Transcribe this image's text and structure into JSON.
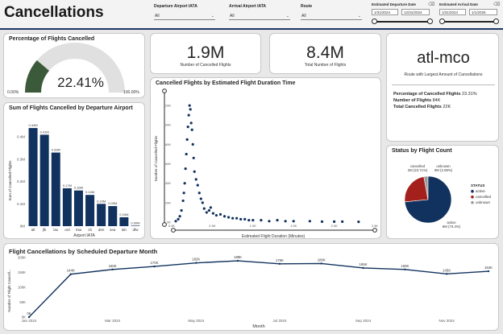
{
  "header": {
    "title": "Cancellations",
    "slicers": [
      {
        "label": "Departure Airport IATA",
        "value": "All"
      },
      {
        "label": "Arrival Airport IATA",
        "value": "All"
      },
      {
        "label": "Route",
        "value": "All"
      }
    ],
    "departure_date": {
      "label": "Estimated Departure Date",
      "from": "1/31/2024",
      "to": "12/31/2024"
    },
    "arrival_date": {
      "label": "Estimated Arrival Date",
      "from": "1/31/2024",
      "to": "1/1/2025"
    }
  },
  "gauge": {
    "title": "Percentage of Flights Cancelled",
    "value": "22.41%",
    "min_label": "0.00%",
    "max_label": "100.00%",
    "fraction": 0.2241
  },
  "kpis": [
    {
      "value": "1.9M",
      "label": "Number of Cancelled Flights"
    },
    {
      "value": "8.4M",
      "label": "Total Number of Flights"
    }
  ],
  "route_card": {
    "value": "atl-mco",
    "label": "Route with Largest Amount of Cancellations",
    "stats": [
      {
        "label": "Percentage of Cancelled Flights",
        "value": "23.31%"
      },
      {
        "label": "Number of Flights",
        "value": "84K"
      },
      {
        "label": "Total Cancelled Flights",
        "value": "22K"
      }
    ]
  },
  "colors": {
    "navy": "#11325e",
    "green": "#3b5a3a",
    "red": "#a4201d",
    "gray": "#9a9a9a",
    "gauge_bg": "#e0e0e0"
  },
  "chart_data": [
    {
      "type": "bar",
      "title": "Sum of Flights Cancelled by Departure Airport",
      "xlabel": "Airport IATA",
      "ylabel": "Sum of Cancelled Flights",
      "categories": [
        "atl",
        "jfk",
        "lax",
        "ord",
        "mia",
        "clt",
        "den",
        "sea",
        "lah",
        "dfw"
      ],
      "values": [
        0.44,
        0.41,
        0.33,
        0.17,
        0.16,
        0.14,
        0.1,
        0.09,
        0.04,
        0.0
      ],
      "data_labels": [
        "0.44M",
        "0.41M",
        "0.33M",
        "0.17M",
        "0.16M",
        "0.14M",
        "0.10M",
        "0.09M",
        "0.04M",
        "0.00M"
      ],
      "yticks": [
        "0M",
        "0.1M",
        "0.2M",
        "0.3M",
        "0.4M"
      ],
      "ylim": [
        0,
        0.48
      ]
    },
    {
      "type": "scatter",
      "title": "Cancelled Flights by Estimated Flight Duration Time",
      "xlabel": "Estimated Flight Duration (Minutes)",
      "ylabel": "Number of Cancelled Flights",
      "xticks": [
        "0.0K",
        "0.5K",
        "1.0K",
        "1.5K",
        "2.0K",
        "2.5K"
      ],
      "yticks": [
        "0K",
        "20K",
        "40K",
        "60K",
        "80K",
        "100K",
        "120K"
      ],
      "xlim": [
        0,
        2.5
      ],
      "ylim": [
        0,
        130
      ],
      "points": [
        [
          0.05,
          1
        ],
        [
          0.08,
          3
        ],
        [
          0.1,
          6
        ],
        [
          0.12,
          12
        ],
        [
          0.14,
          22
        ],
        [
          0.15,
          30
        ],
        [
          0.16,
          40
        ],
        [
          0.17,
          55
        ],
        [
          0.18,
          70
        ],
        [
          0.19,
          85
        ],
        [
          0.2,
          98
        ],
        [
          0.21,
          110
        ],
        [
          0.22,
          120
        ],
        [
          0.23,
          116
        ],
        [
          0.24,
          102
        ],
        [
          0.25,
          95
        ],
        [
          0.26,
          80
        ],
        [
          0.27,
          66
        ],
        [
          0.28,
          52
        ],
        [
          0.3,
          44
        ],
        [
          0.32,
          38
        ],
        [
          0.34,
          30
        ],
        [
          0.36,
          24
        ],
        [
          0.38,
          20
        ],
        [
          0.4,
          14
        ],
        [
          0.43,
          10
        ],
        [
          0.46,
          12
        ],
        [
          0.48,
          15
        ],
        [
          0.51,
          9
        ],
        [
          0.55,
          7
        ],
        [
          0.6,
          8
        ],
        [
          0.65,
          6
        ],
        [
          0.7,
          5
        ],
        [
          0.75,
          4
        ],
        [
          0.8,
          4
        ],
        [
          0.85,
          3
        ],
        [
          0.9,
          3
        ],
        [
          0.95,
          2
        ],
        [
          1.0,
          2
        ],
        [
          1.1,
          2
        ],
        [
          1.2,
          1
        ],
        [
          1.3,
          2
        ],
        [
          1.4,
          1
        ],
        [
          1.5,
          1
        ],
        [
          1.7,
          1
        ],
        [
          1.85,
          0.5
        ],
        [
          2.0,
          0.5
        ],
        [
          2.1,
          0.5
        ],
        [
          2.3,
          0.3
        ]
      ]
    },
    {
      "type": "pie",
      "title": "Status by Flight Count",
      "legend_title": "STATUS",
      "slices": [
        {
          "name": "active",
          "value": 73.4,
          "label": "active",
          "label2": "6M (73.4%)",
          "color": "#11325e"
        },
        {
          "name": "cancelled",
          "value": 23.71,
          "label": "cancelled",
          "label2": "2M (23.71%)",
          "color": "#a4201d"
        },
        {
          "name": "unknown",
          "value": 2.89,
          "label": "unknown",
          "label2": "0M (2.89%)",
          "color": "#9a9a9a"
        }
      ]
    },
    {
      "type": "line",
      "title": "Flight Cancellations by Scheduled Departure Month",
      "xlabel": "Month",
      "ylabel": "Number of Flight Cancell...",
      "x": [
        "Jan 2024",
        "Feb 2024",
        "Mar 2024",
        "Apr 2024",
        "May 2024",
        "Jun 2024",
        "Jul 2024",
        "Aug 2024",
        "Sep 2024",
        "Oct 2024",
        "Nov 2024",
        "Dec 2024"
      ],
      "xticks": [
        "Jan 2024",
        "Mar 2024",
        "May 2024",
        "Jul 2024",
        "Sep 2024",
        "Nov 2024"
      ],
      "values": [
        0,
        144,
        160,
        170,
        182,
        189,
        179,
        180,
        165,
        160,
        145,
        154
      ],
      "data_labels": [
        "0K",
        "144K",
        "160K",
        "170K",
        "182K",
        "189K",
        "179K",
        "180K",
        "165K",
        "160K",
        "145K",
        "154K"
      ],
      "yticks": [
        "0K",
        "50K",
        "100K",
        "150K",
        "200K"
      ],
      "ylim": [
        0,
        200
      ]
    }
  ]
}
